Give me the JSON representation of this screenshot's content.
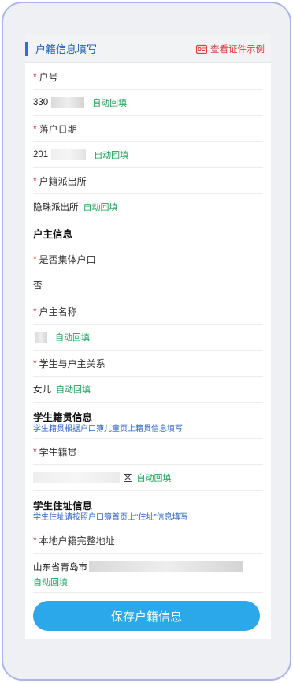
{
  "header": {
    "title": "户籍信息填写",
    "view_sample": "查看证件示例"
  },
  "fields": {
    "household_no": {
      "label": "户号",
      "value": "330",
      "auto": "自动回填"
    },
    "register_date": {
      "label": "落户日期",
      "value": "201",
      "auto": "自动回填"
    },
    "police_station": {
      "label": "户籍派出所",
      "value": "隐珠派出所",
      "auto": "自动回填"
    }
  },
  "head_section": {
    "title": "户主信息"
  },
  "collective": {
    "label": "是否集体户口",
    "value": "否"
  },
  "head_name": {
    "label": "户主名称",
    "auto": "自动回填"
  },
  "relation": {
    "label": "学生与户主关系",
    "value": "女儿",
    "auto": "自动回填"
  },
  "native_section": {
    "title": "学生籍贯信息",
    "hint": "学生籍贯根据户口簿儿童页上籍贯信息填写"
  },
  "native": {
    "label": "学生籍贯",
    "value_tail": "区",
    "auto": "自动回填"
  },
  "address_section": {
    "title": "学生住址信息",
    "hint": "学生住址请按照户口簿首页上“住址”信息填写"
  },
  "address": {
    "label": "本地户籍完整地址",
    "value": "山东省青岛市",
    "auto": "自动回填"
  },
  "save_button": "保存户籍信息",
  "colors": {
    "accent": "#2f6fd6",
    "required": "#e02a2a",
    "auto": "#1aa35a",
    "button": "#2aa8ea",
    "hint": "#2a64c8"
  }
}
